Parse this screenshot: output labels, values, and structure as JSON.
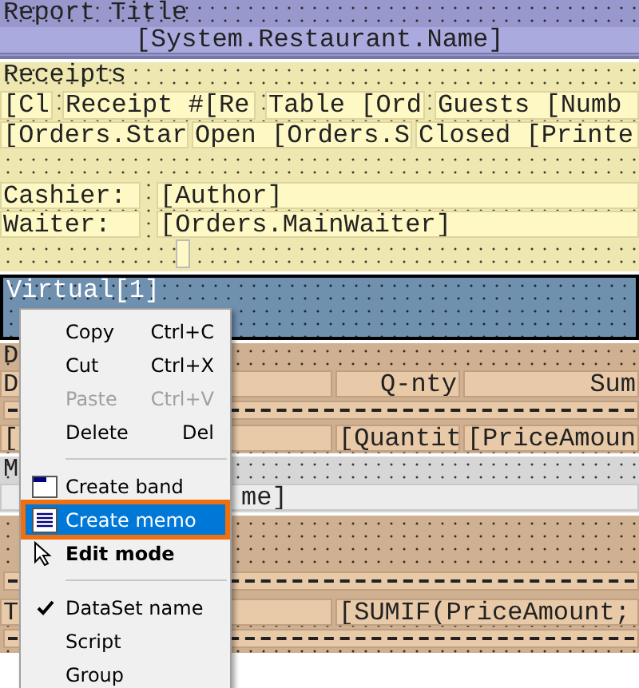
{
  "bands": [
    {
      "kind": "title",
      "rows": [
        {
          "kind": "label",
          "cells": [
            "Report Title"
          ]
        },
        {
          "kind": "banner",
          "cells": [
            "[System.Restaurant.Name]"
          ]
        }
      ]
    },
    {
      "kind": "header",
      "rows": [
        {
          "kind": "label",
          "cells": [
            "Receipts"
          ]
        },
        {
          "kind": "four",
          "memos": [
            "[Cl",
            "Receipt #[Re",
            "Table [Ord",
            "Guests [Numb"
          ]
        },
        {
          "kind": "three",
          "memos": [
            "[Orders.Star",
            "Open [Orders.S",
            "Closed [Printe"
          ]
        },
        {
          "kind": "blank",
          "cells": []
        },
        {
          "kind": "pair",
          "cells": [
            "Cashier:",
            "[Author]"
          ]
        },
        {
          "kind": "pair",
          "cells": [
            "Waiter:",
            "[Orders.MainWaiter]"
          ]
        },
        {
          "kind": "stub",
          "cells": []
        }
      ]
    },
    {
      "kind": "virtual",
      "rows": [
        {
          "kind": "label",
          "cells": [
            "Virtual[1]"
          ]
        },
        {
          "kind": "blank",
          "cells": []
        }
      ]
    },
    {
      "kind": "detail",
      "rows": [
        {
          "kind": "label",
          "cells": [
            "D"
          ]
        },
        {
          "kind": "qty",
          "cells": [
            "D",
            "Q-nty",
            "Sum"
          ]
        },
        {
          "kind": "dashes",
          "cells": []
        },
        {
          "kind": "qty",
          "cells": [
            "[",
            "[Quantit",
            "[PriceAmoun"
          ]
        }
      ]
    },
    {
      "kind": "group",
      "rows": [
        {
          "kind": "label",
          "cells": [
            "M"
          ]
        },
        {
          "kind": "offset",
          "cells": [
            "me]"
          ]
        }
      ]
    },
    {
      "kind": "detail",
      "rows": [
        {
          "kind": "tall",
          "cells": []
        },
        {
          "kind": "dashes",
          "cells": []
        },
        {
          "kind": "total",
          "cells": [
            "T",
            "[SUMIF(PriceAmount;"
          ]
        },
        {
          "kind": "dashes",
          "cells": []
        }
      ]
    }
  ],
  "menu": [
    {
      "kind": "command",
      "label": "Copy",
      "shortcut": "Ctrl+C",
      "disabled": false,
      "selected": false
    },
    {
      "kind": "command",
      "label": "Cut",
      "shortcut": "Ctrl+X",
      "disabled": false,
      "selected": false
    },
    {
      "kind": "command",
      "label": "Paste",
      "shortcut": "Ctrl+V",
      "disabled": true,
      "selected": false
    },
    {
      "kind": "command",
      "label": "Delete",
      "shortcut": "Del",
      "disabled": false,
      "selected": false
    },
    {
      "kind": "separator"
    },
    {
      "kind": "band",
      "label": "Create band",
      "disabled": false,
      "selected": false
    },
    {
      "kind": "memo",
      "label": "Create memo",
      "disabled": false,
      "selected": true
    },
    {
      "kind": "mode",
      "label": "Edit mode",
      "disabled": false,
      "selected": false
    },
    {
      "kind": "separator"
    },
    {
      "kind": "toggle",
      "label": "DataSet name",
      "checked": true,
      "disabled": false,
      "selected": false
    },
    {
      "kind": "command",
      "label": "Script",
      "disabled": false,
      "selected": false
    },
    {
      "kind": "command",
      "label": "Group",
      "disabled": false,
      "selected": false
    }
  ]
}
